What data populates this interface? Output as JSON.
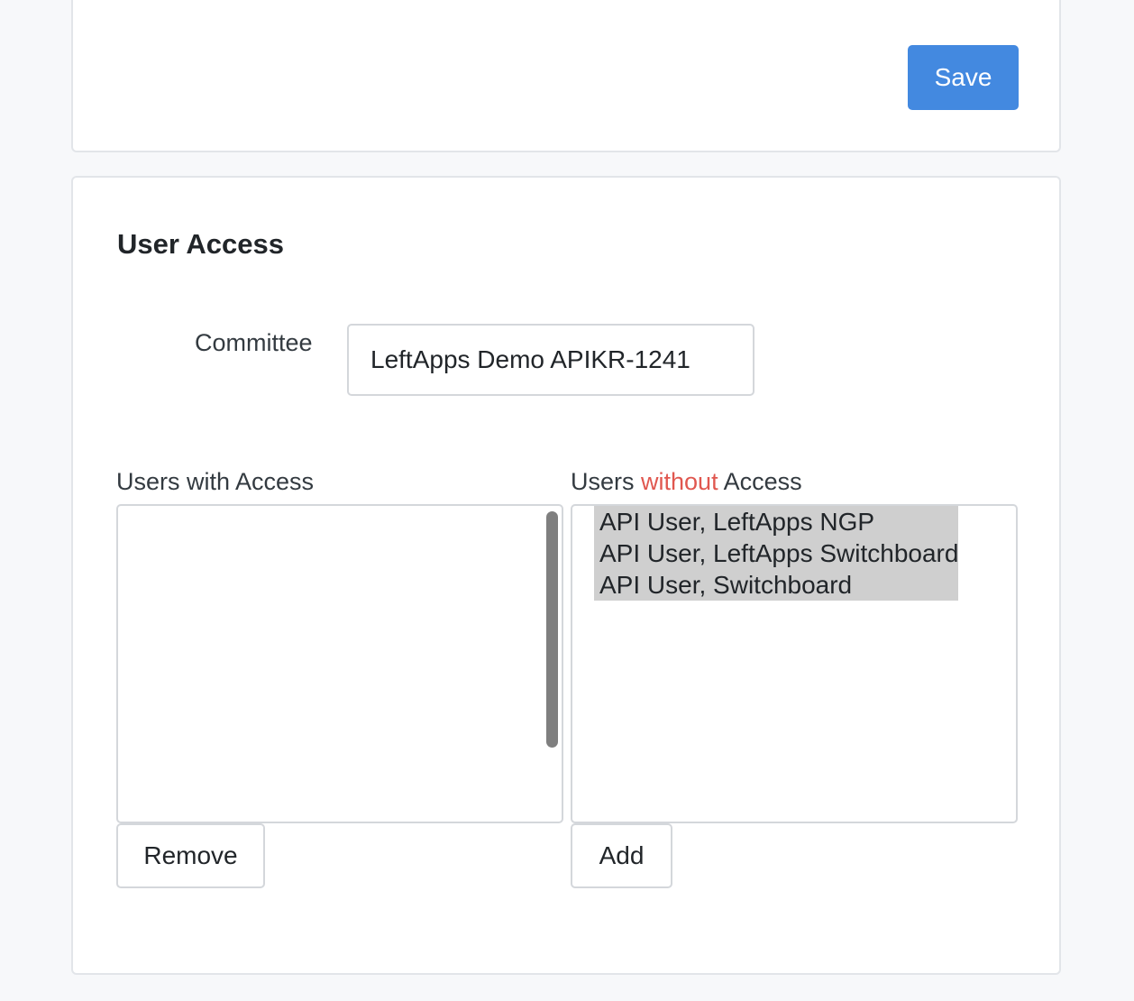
{
  "top_card": {
    "save_label": "Save"
  },
  "user_access": {
    "title": "User Access",
    "committee": {
      "label": "Committee",
      "value": "LeftApps Demo APIKR-1241"
    },
    "users_with_access": {
      "label": "Users with Access",
      "items": []
    },
    "users_without_access": {
      "label_prefix": "Users ",
      "label_emphasis": "without",
      "label_suffix": " Access",
      "items": [
        "API User, LeftApps NGP",
        "API User, LeftApps Switchboard",
        "API User, Switchboard"
      ]
    },
    "remove_label": "Remove",
    "add_label": "Add"
  },
  "colors": {
    "primary": "#4389e0",
    "emphasis": "#e0574f",
    "selected_option_bg": "#cfcfcf",
    "page_bg": "#f7f8fa"
  }
}
